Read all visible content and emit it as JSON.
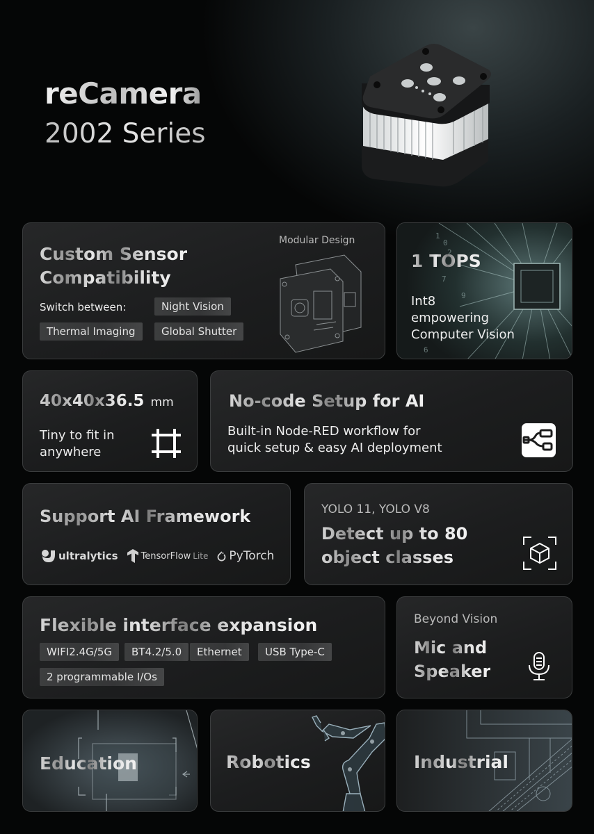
{
  "hero": {
    "title": "reCamera",
    "subtitle": "2002 Series"
  },
  "cards": {
    "sensor": {
      "title_line1": "Custom Sensor",
      "title_line2": "Compatibility",
      "switch_label": "Switch between:",
      "tags": [
        "Night Vision",
        "Thermal Imaging",
        "Global Shutter"
      ],
      "caption": "Modular Design",
      "image_icon": "modular-board-icon"
    },
    "tops": {
      "title": "1 TOPS",
      "desc_lines": [
        "Int8",
        "empowering",
        "Computer Vision"
      ],
      "image_icon": "chip-icon"
    },
    "size": {
      "value": "40x40x36.5",
      "unit": "mm",
      "desc_lines": [
        "Tiny to fit in",
        "anywhere"
      ],
      "icon": "frame-icon"
    },
    "nocode": {
      "title": "No-code Setup for AI",
      "desc_lines": [
        "Built-in Node-RED workflow for",
        "quick setup & easy AI deployment"
      ],
      "icon": "node-red-icon"
    },
    "framework": {
      "title": "Support AI Framework",
      "logos": [
        {
          "name": "ultralytics",
          "icon": "ultralytics-logo-icon"
        },
        {
          "name": "TensorFlow",
          "suffix": "Lite",
          "icon": "tensorflow-logo-icon"
        },
        {
          "name": "PyTorch",
          "icon": "pytorch-logo-icon"
        }
      ]
    },
    "yolo": {
      "kicker": "YOLO 11, YOLO V8",
      "title_line1": "Detect up to 80",
      "title_line2": "object classes",
      "icon": "3d-object-scan-icon"
    },
    "interface": {
      "title": "Flexible interface expansion",
      "tags": [
        "WIFI2.4G/5G",
        "BT4.2/5.0",
        "Ethernet",
        "USB Type-C",
        "2 programmable I/Os"
      ]
    },
    "mic": {
      "kicker": "Beyond Vision",
      "title_line1": "Mic and",
      "title_line2": "Speaker",
      "icon": "microphone-icon"
    },
    "education": {
      "label": "Education"
    },
    "robotics": {
      "label": "Robotics"
    },
    "industrial": {
      "label": "Industrial"
    }
  }
}
